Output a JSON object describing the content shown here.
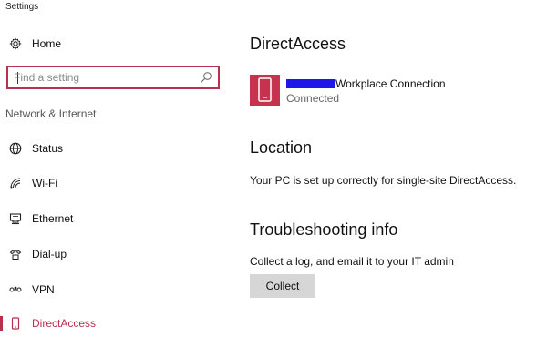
{
  "window": {
    "title": "Settings"
  },
  "sidebar": {
    "home": {
      "label": "Home",
      "icon": "gear-icon"
    },
    "search": {
      "placeholder": "Find a setting",
      "icon": "search-icon"
    },
    "section_label": "Network & Internet",
    "items": [
      {
        "label": "Status",
        "icon": "globe-icon",
        "selected": false
      },
      {
        "label": "Wi-Fi",
        "icon": "wifi-icon",
        "selected": false
      },
      {
        "label": "Ethernet",
        "icon": "ethernet-icon",
        "selected": false
      },
      {
        "label": "Dial-up",
        "icon": "dialup-icon",
        "selected": false
      },
      {
        "label": "VPN",
        "icon": "vpn-icon",
        "selected": false
      },
      {
        "label": "DirectAccess",
        "icon": "phone-icon",
        "selected": true
      }
    ]
  },
  "main": {
    "title": "DirectAccess",
    "connection": {
      "name": "Workplace Connection",
      "status": "Connected",
      "icon": "phone-icon"
    },
    "location": {
      "title": "Location",
      "text": "Your PC is set up correctly for single-site DirectAccess."
    },
    "troubleshooting": {
      "title": "Troubleshooting info",
      "text": "Collect a log, and email it to your IT admin",
      "button_label": "Collect"
    }
  },
  "colors": {
    "accent": "#b6314d",
    "tile": "#c7334f",
    "redaction": "#1f16e8",
    "button_bg": "#d6d6d6"
  }
}
